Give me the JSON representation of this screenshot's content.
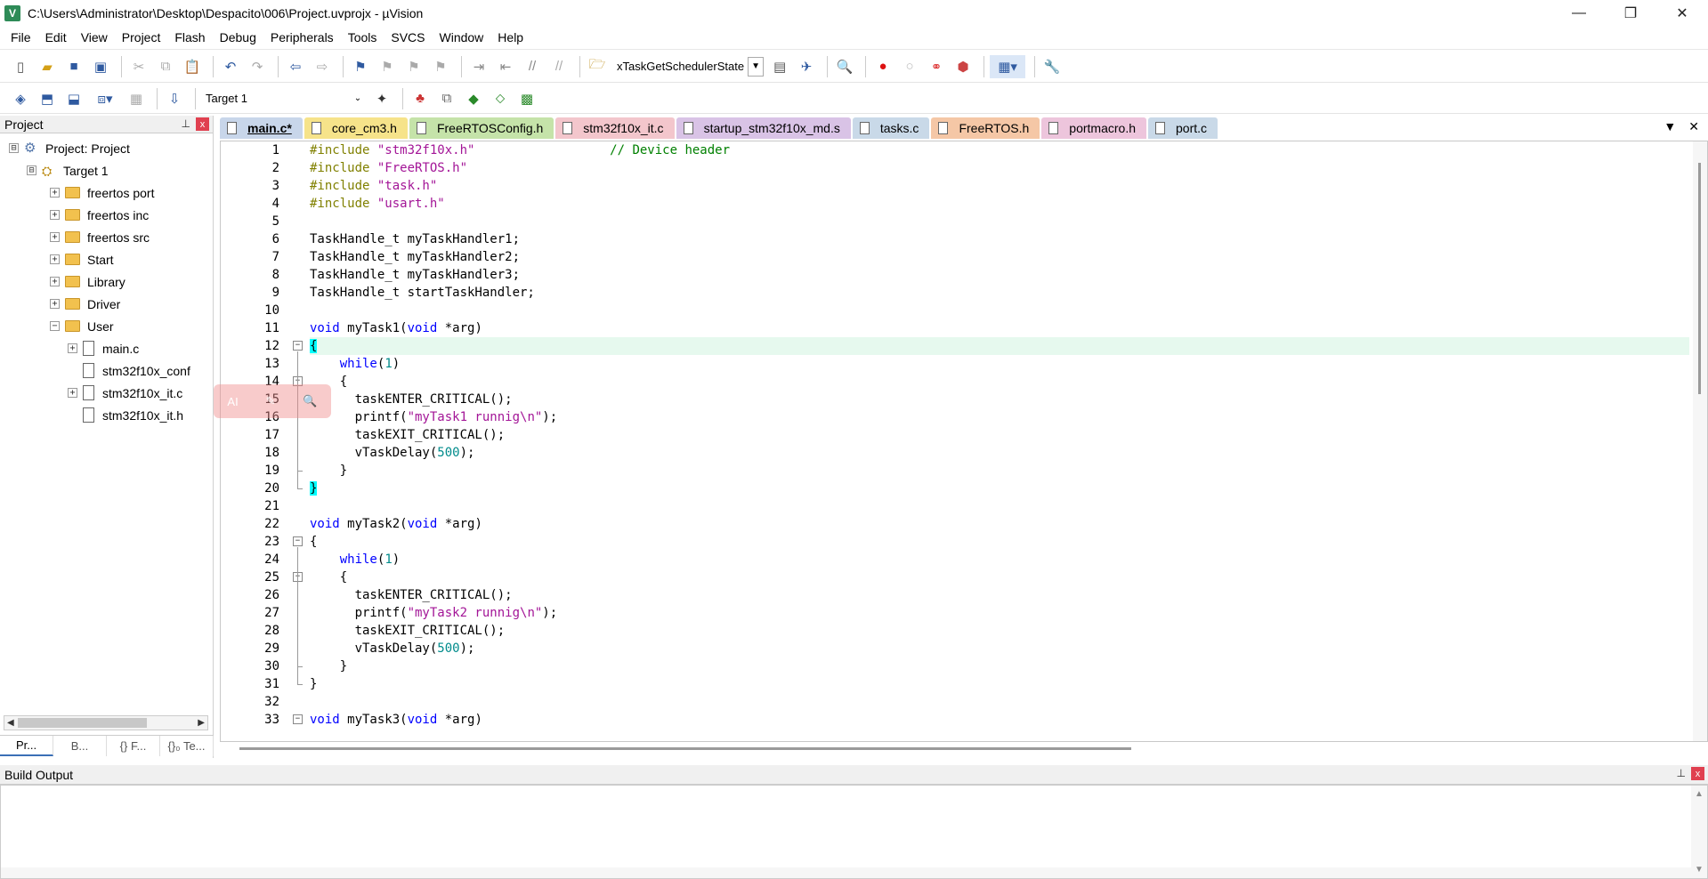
{
  "window": {
    "title": "C:\\Users\\Administrator\\Desktop\\Despacito\\006\\Project.uvprojx - µVision",
    "app_icon_letter": "V",
    "minimize": "—",
    "maximize": "❐",
    "close": "✕"
  },
  "menu": [
    "File",
    "Edit",
    "View",
    "Project",
    "Flash",
    "Debug",
    "Peripherals",
    "Tools",
    "SVCS",
    "Window",
    "Help"
  ],
  "toolbar1": {
    "find_combo_value": "xTaskGetSchedulerState"
  },
  "toolbar2": {
    "target_value": "Target 1"
  },
  "project_panel": {
    "title": "Project",
    "pin": "📌",
    "close": "x",
    "tree": [
      {
        "label": "Project: Project",
        "level": 0,
        "type": "project",
        "expander": "⊟"
      },
      {
        "label": "Target 1",
        "level": 1,
        "type": "target",
        "expander": "⊟"
      },
      {
        "label": "freertos port",
        "level": 2,
        "type": "folder",
        "expander": "+"
      },
      {
        "label": "freertos inc",
        "level": 2,
        "type": "folder",
        "expander": "+"
      },
      {
        "label": "freertos src",
        "level": 2,
        "type": "folder",
        "expander": "+"
      },
      {
        "label": "Start",
        "level": 2,
        "type": "folder",
        "expander": "+"
      },
      {
        "label": "Library",
        "level": 2,
        "type": "folder",
        "expander": "+"
      },
      {
        "label": "Driver",
        "level": 2,
        "type": "folder",
        "expander": "+"
      },
      {
        "label": "User",
        "level": 2,
        "type": "folder",
        "expander": "−"
      },
      {
        "label": "main.c",
        "level": 3,
        "type": "file",
        "expander": "+"
      },
      {
        "label": "stm32f10x_conf",
        "level": 3,
        "type": "file",
        "expander": ""
      },
      {
        "label": "stm32f10x_it.c",
        "level": 3,
        "type": "file",
        "expander": "+"
      },
      {
        "label": "stm32f10x_it.h",
        "level": 3,
        "type": "file",
        "expander": ""
      }
    ],
    "tabs": [
      "Pr...",
      "B...",
      "{} F...",
      "{}₀ Te..."
    ]
  },
  "editor": {
    "tabs": [
      {
        "label": "main.c*",
        "color": "#c8d6ea",
        "active": true
      },
      {
        "label": "core_cm3.h",
        "color": "#f6e38a"
      },
      {
        "label": "FreeRTOSConfig.h",
        "color": "#c5e3a9"
      },
      {
        "label": "stm32f10x_it.c",
        "color": "#f3c6cc"
      },
      {
        "label": "startup_stm32f10x_md.s",
        "color": "#d9c3e6"
      },
      {
        "label": "tasks.c",
        "color": "#c9d9e8"
      },
      {
        "label": "FreeRTOS.h",
        "color": "#f5c7a6"
      },
      {
        "label": "portmacro.h",
        "color": "#edc5dc"
      },
      {
        "label": "port.c",
        "color": "#c9d9e8"
      }
    ],
    "tab_menu": "▼",
    "tab_close": "✕",
    "line_numbers": [
      "1",
      "2",
      "3",
      "4",
      "5",
      "6",
      "7",
      "8",
      "9",
      "10",
      "11",
      "12",
      "13",
      "14",
      "15",
      "16",
      "17",
      "18",
      "19",
      "20",
      "21",
      "22",
      "23",
      "24",
      "25",
      "26",
      "27",
      "28",
      "29",
      "30",
      "31",
      "32",
      "33"
    ],
    "code": {
      "l1_pp": "#include ",
      "l1_str": "\"stm32f10x.h\"",
      "l1_ws": "                  ",
      "l1_cmt": "// Device header",
      "l2_pp": "#include ",
      "l2_str": "\"FreeRTOS.h\"",
      "l3_pp": "#include ",
      "l3_str": "\"task.h\"",
      "l4_pp": "#include ",
      "l4_str": "\"usart.h\"",
      "l6": "TaskHandle_t myTaskHandler1;",
      "l7": "TaskHandle_t myTaskHandler2;",
      "l8": "TaskHandle_t myTaskHandler3;",
      "l9": "TaskHandle_t startTaskHandler;",
      "void": "void",
      "l11_name": " myTask1(",
      "l22_name": " myTask2(",
      "l33_name": " myTask3(",
      "arg": " *arg)",
      "open_brace": "{",
      "close_brace": "}",
      "while_indent": "    ",
      "while": "while",
      "paren_open": "(",
      "one": "1",
      "paren_close": ")",
      "inner_open": "    {",
      "inner_close": "    }",
      "enter": "      taskENTER_CRITICAL();",
      "printf_pre": "      printf(",
      "printf_str1": "\"myTask1 runnig\\n\"",
      "printf_str2": "\"myTask2 runnig\\n\"",
      "printf_post": ");",
      "exit": "      taskEXIT_CRITICAL();",
      "delay_pre": "      vTaskDelay(",
      "delay_val": "500",
      "delay_post": ");"
    }
  },
  "ai_bubble": {
    "ai": "AI",
    "edit": "✎",
    "search": "🔍"
  },
  "build_output": {
    "title": "Build Output",
    "pin": "📌",
    "close": "x"
  },
  "colors": {
    "current_line": "#e6f9ee",
    "brace_highlight": "#00ffff",
    "keyword": "#0000ff",
    "preprocessor": "#808000",
    "string": "#a31597",
    "comment": "#008000",
    "number": "#008b8b"
  }
}
